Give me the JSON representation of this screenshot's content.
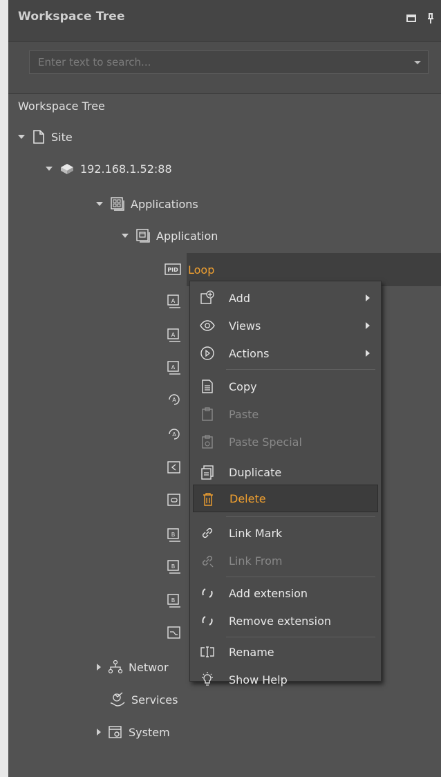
{
  "panel": {
    "title": "Workspace Tree",
    "buttons": [
      {
        "icon": "maximize-icon"
      },
      {
        "icon": "pin-icon"
      }
    ]
  },
  "search": {
    "placeholder": "Enter text to search..."
  },
  "tree": {
    "header": "Workspace Tree",
    "nodes": [
      {
        "label": "Site",
        "icon": "file-icon",
        "expander": "expanded"
      },
      {
        "label": "192.168.1.52:88",
        "icon": "server-icon",
        "expander": "expanded"
      },
      {
        "label": "Applications",
        "icon": "applications-icon",
        "expander": "expanded"
      },
      {
        "label": "Application",
        "icon": "application-icon",
        "expander": "expanded"
      },
      {
        "label": "Loop",
        "icon": "pid-icon",
        "selected": true
      },
      {
        "label": "Networks",
        "shown_text": "Networ",
        "icon": "network-icon",
        "expander": "collapsed"
      },
      {
        "label": "Services",
        "shown_text": "Services",
        "icon": "services-icon"
      },
      {
        "label": "System",
        "icon": "system-icon",
        "expander": "collapsed"
      }
    ],
    "hidden_children_icons": [
      "analog-icon",
      "analog-icon",
      "analog-icon",
      "analog-loop-icon",
      "analog-loop-icon",
      "compare-icon",
      "link-icon",
      "binary-icon",
      "binary-icon",
      "binary-icon",
      "trend-icon"
    ],
    "colors": {
      "selected_text": "#f0a030",
      "background": "#525252"
    }
  },
  "context_menu": {
    "items": [
      {
        "label": "Add",
        "icon": "add-icon",
        "submenu": true,
        "enabled": true
      },
      {
        "label": "Views",
        "icon": "eye-icon",
        "submenu": true,
        "enabled": true
      },
      {
        "label": "Actions",
        "icon": "play-circle-icon",
        "submenu": true,
        "enabled": true
      },
      {
        "label": "Copy",
        "icon": "copy-icon",
        "enabled": true
      },
      {
        "label": "Paste",
        "icon": "paste-icon",
        "enabled": false
      },
      {
        "label": "Paste Special",
        "icon": "paste-special-icon",
        "enabled": false
      },
      {
        "label": "Duplicate",
        "icon": "duplicate-icon",
        "enabled": true
      },
      {
        "label": "Delete",
        "icon": "trash-icon",
        "enabled": true,
        "hovered": true
      },
      {
        "label": "Link Mark",
        "icon": "link-mark-icon",
        "enabled": true
      },
      {
        "label": "Link From",
        "icon": "link-from-icon",
        "enabled": false
      },
      {
        "label": "Add extension",
        "icon": "extension-icon",
        "enabled": true
      },
      {
        "label": "Remove extension",
        "icon": "extension-icon",
        "enabled": true
      },
      {
        "label": "Rename",
        "icon": "rename-icon",
        "enabled": true
      },
      {
        "label": "Show Help",
        "icon": "lightbulb-icon",
        "enabled": true
      }
    ],
    "colors": {
      "highlight_text": "#f0a030",
      "disabled_text": "#888888"
    }
  }
}
